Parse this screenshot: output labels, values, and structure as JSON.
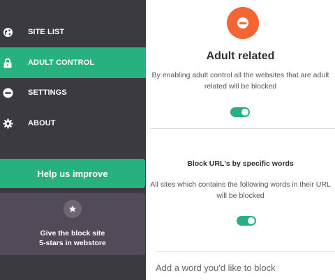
{
  "sidebar": {
    "items": [
      {
        "label": "SITE LIST",
        "icon": "globe-icon",
        "active": false
      },
      {
        "label": "ADULT CONTROL",
        "icon": "lock-icon",
        "active": true
      },
      {
        "label": "SETTINGS",
        "icon": "minus-circle-icon",
        "active": false
      },
      {
        "label": "ABOUT",
        "icon": "gear-icon",
        "active": false
      }
    ],
    "help_label": "Help us improve",
    "rate": {
      "line1": "Give the block site",
      "line2": "5-stars in webstore",
      "icon": "star-icon"
    }
  },
  "adult": {
    "title": "Adult related",
    "desc_line1": "By enabling adult control all the websites that are adult",
    "desc_line2": "related will be blocked",
    "enabled": true
  },
  "words": {
    "title": "Block URL's by specific words",
    "desc_line1": "All sites which contains the following words in their URL",
    "desc_line2": "will be blocked",
    "enabled": true,
    "placeholder": "Add a word you'd like to block"
  },
  "colors": {
    "accent": "#27b17f",
    "sidebar": "#3a3a40",
    "hero": "#f36533",
    "rate_card": "#524a56"
  }
}
